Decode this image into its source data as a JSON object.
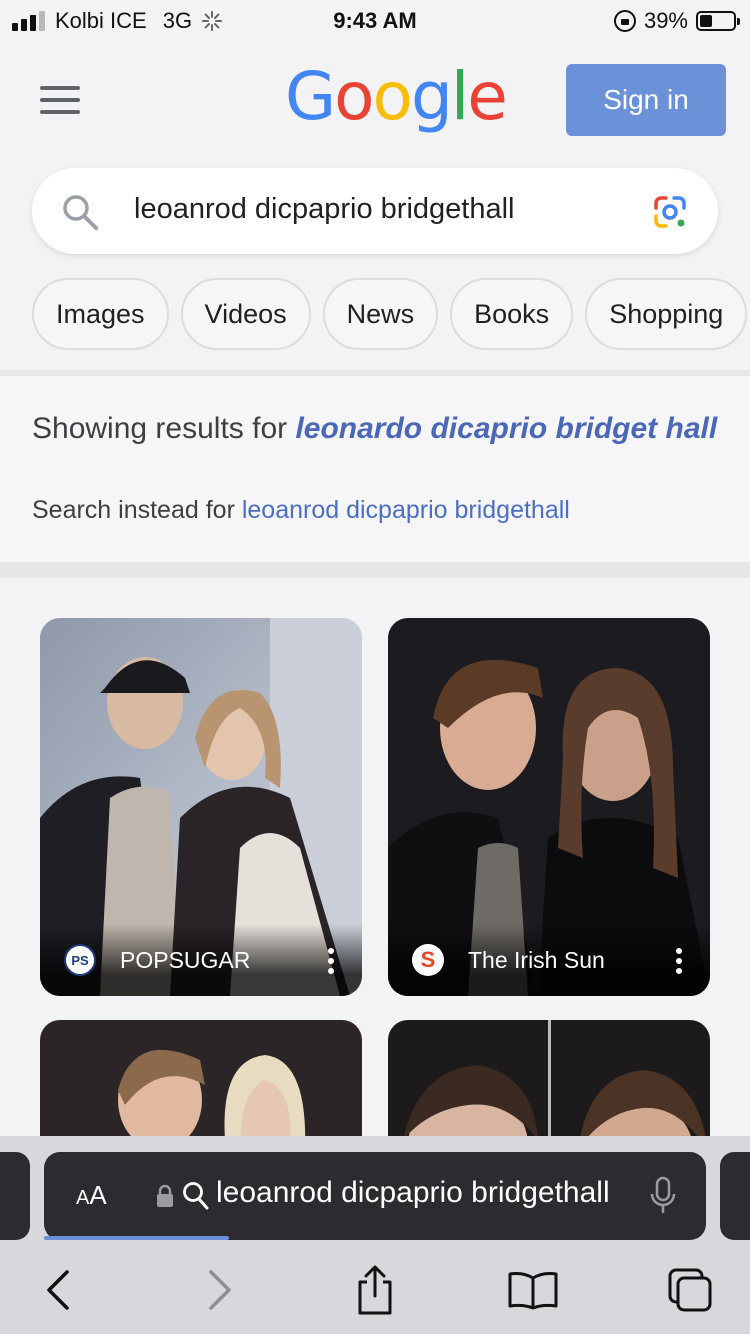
{
  "status_bar": {
    "carrier": "Kolbi ICE",
    "network": "3G",
    "time": "9:43 AM",
    "battery_percent_label": "39%",
    "battery_level": 0.39
  },
  "header": {
    "logo_letters": [
      {
        "char": "G",
        "color": "#4285f4"
      },
      {
        "char": "o",
        "color": "#ea4335"
      },
      {
        "char": "o",
        "color": "#fbbc05"
      },
      {
        "char": "g",
        "color": "#4285f4"
      },
      {
        "char": "l",
        "color": "#34a853"
      },
      {
        "char": "e",
        "color": "#ea4335"
      }
    ],
    "sign_in_label": "Sign in"
  },
  "search": {
    "query": "leoanrod dicpaprio bridgethall"
  },
  "filters": [
    "Images",
    "Videos",
    "News",
    "Books",
    "Shopping"
  ],
  "spelling": {
    "showing_prefix": "Showing results for ",
    "corrected_query": "leonardo dicaprio bridget hall",
    "instead_prefix": "Search instead for ",
    "original_query": "leoanrod dicpaprio bridgethall"
  },
  "images": [
    {
      "source": "POPSUGAR",
      "icon_text": "PS",
      "icon": "popsugar-icon"
    },
    {
      "source": "The Irish Sun",
      "icon_text": "S",
      "icon": "irish-sun-icon"
    },
    {
      "source": "",
      "icon_text": "",
      "icon": ""
    },
    {
      "source": "",
      "icon_text": "",
      "icon": ""
    }
  ],
  "safari": {
    "aa_label_big": "A",
    "aa_label_small": "A",
    "url_text": "leoanrod dicpaprio bridgethall",
    "load_progress": 0.28,
    "accent_color": "#6b8fd9"
  },
  "colors": {
    "sign_in": "#6b91d9",
    "link": "#4a67b8"
  }
}
